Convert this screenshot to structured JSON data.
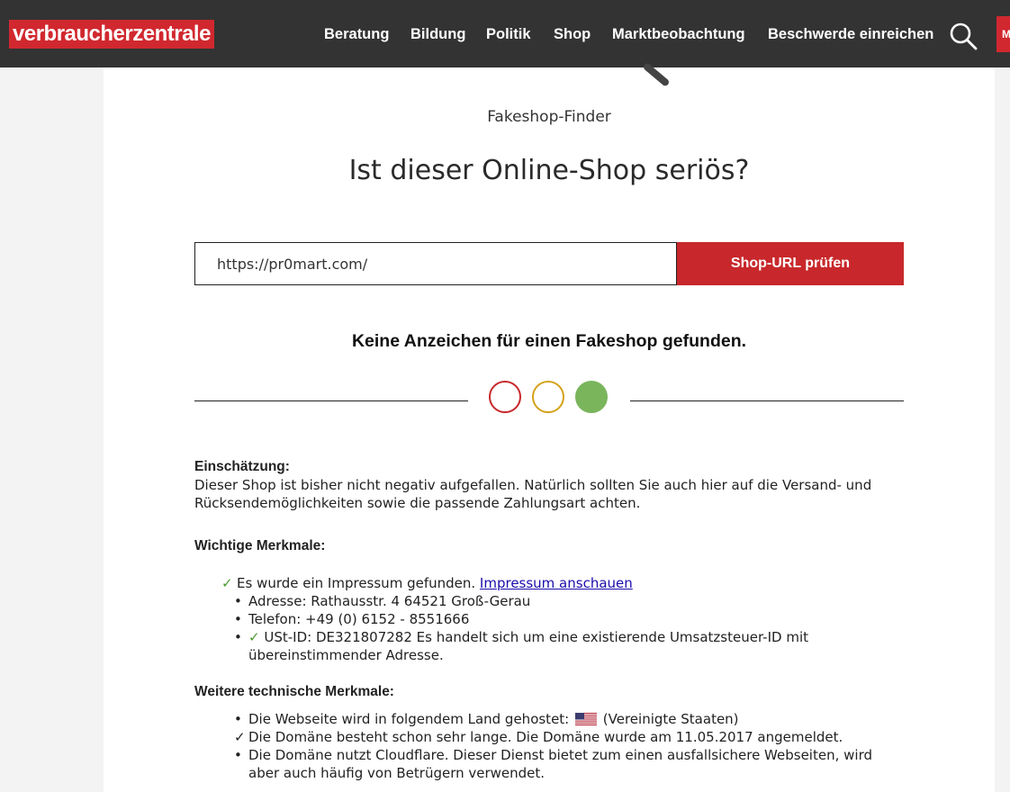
{
  "header": {
    "logo": "verbraucherzentrale",
    "nav": [
      "Beratung",
      "Bildung",
      "Politik",
      "Shop",
      "Marktbeobachtung",
      "Beschwerde einreichen"
    ],
    "red_tab": "M"
  },
  "finder": {
    "kicker": "Fakeshop-Finder",
    "headline": "Ist dieser Online-Shop seriös?",
    "url_value": "https://pr0mart.com/",
    "button": "Shop-URL prüfen",
    "result": "Keine Anzeichen für einen Fakeshop gefunden.",
    "traffic_light": {
      "active": "green",
      "colors": {
        "red": "#c8282b",
        "yellow": "#d4a21a",
        "green": "#7ab55c"
      }
    }
  },
  "assessment": {
    "label": "Einschätzung:",
    "text": "Dieser Shop ist bisher nicht negativ aufgefallen. Natürlich sollten Sie auch hier auf die Versand- und Rücksendemöglichkeiten sowie die passende Zahlungsart achten."
  },
  "features": {
    "label": "Wichtige Merkmale:",
    "impressum_text": "Es wurde ein Impressum gefunden.",
    "impressum_link": "Impressum anschauen",
    "items": [
      "Adresse: Rathausstr. 4 64521 Groß-Gerau",
      "Telefon: +49 (0) 6152 - 8551666",
      "USt-ID: DE321807282 Es handelt sich um eine existierende Umsatzsteuer-ID mit übereinstimmender Adresse."
    ]
  },
  "technical": {
    "label": "Weitere technische Merkmale:",
    "hosted_prefix": "Die Webseite wird in folgendem Land gehostet:",
    "hosted_country": "(Vereinigte Staaten)",
    "domain_age": "Die Domäne besteht schon sehr lange. Die Domäne wurde am 11.05.2017 angemeldet.",
    "cloudflare": "Die Domäne nutzt Cloudflare. Dieser Dienst bietet zum einen ausfallsichere Webseiten, wird aber auch häufig von Betrügern verwendet."
  }
}
